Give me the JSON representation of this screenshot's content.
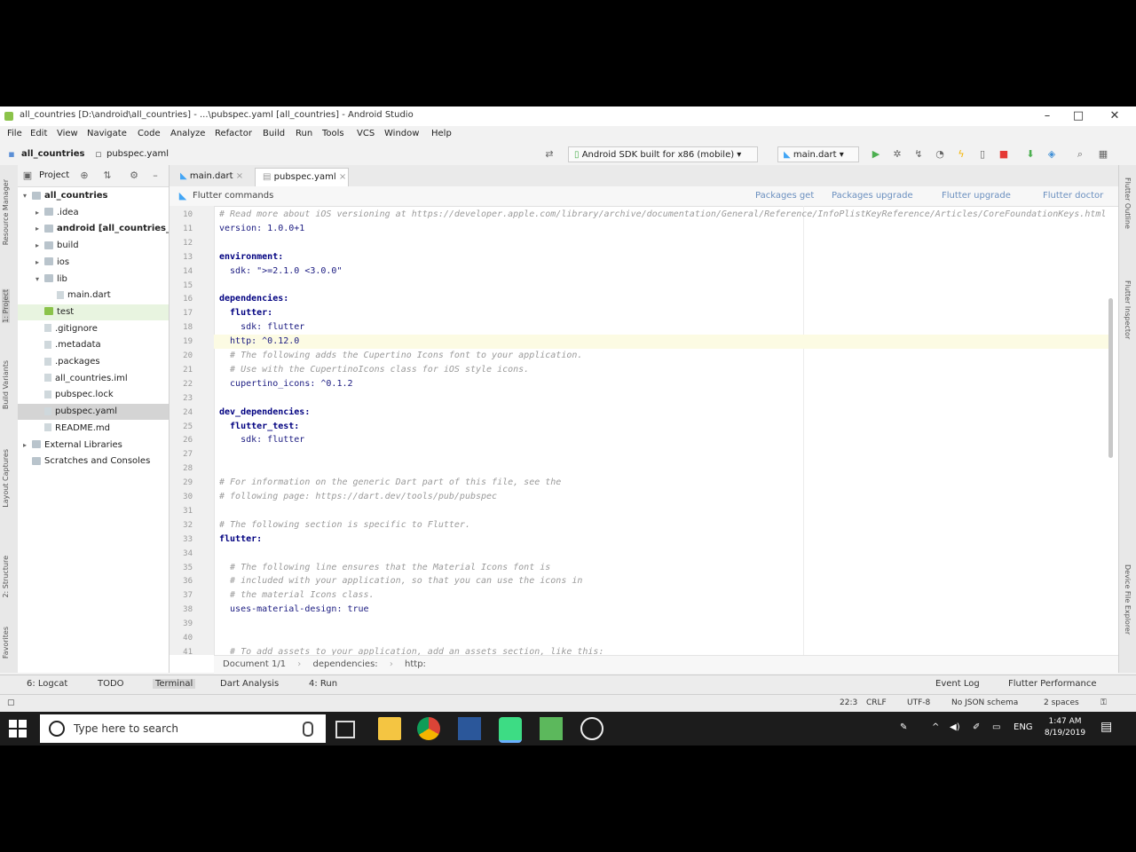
{
  "window": {
    "title": "all_countries [D:\\android\\all_countries] - ...\\pubspec.yaml [all_countries] - Android Studio",
    "controls": [
      "–",
      "□",
      "✕"
    ]
  },
  "menu": [
    "File",
    "Edit",
    "View",
    "Navigate",
    "Code",
    "Analyze",
    "Refactor",
    "Build",
    "Run",
    "Tools",
    "VCS",
    "Window",
    "Help"
  ],
  "navbar": {
    "project_crumb": "all_countries",
    "file_crumb": "pubspec.yaml",
    "device_combo": "Android SDK built for x86 (mobile)",
    "run_config": "main.dart"
  },
  "project_panel": {
    "title": "Project",
    "root_hint": "D:\\android\\all_countries",
    "items": [
      {
        "label": "all_countries",
        "indent": 0,
        "type": "folder",
        "arrow": "▾"
      },
      {
        "label": ".idea",
        "indent": 1,
        "type": "folder",
        "arrow": "▸"
      },
      {
        "label": "android [all_countries_android]",
        "indent": 1,
        "type": "folder",
        "arrow": "▸"
      },
      {
        "label": "build",
        "indent": 1,
        "type": "folder",
        "arrow": "▸"
      },
      {
        "label": "ios",
        "indent": 1,
        "type": "folder",
        "arrow": "▸"
      },
      {
        "label": "lib",
        "indent": 1,
        "type": "folder",
        "arrow": "▾"
      },
      {
        "label": "main.dart",
        "indent": 2,
        "type": "file",
        "arrow": ""
      },
      {
        "label": "test",
        "indent": 1,
        "type": "folder",
        "arrow": ""
      },
      {
        "label": ".gitignore",
        "indent": 1,
        "type": "file",
        "arrow": ""
      },
      {
        "label": ".metadata",
        "indent": 1,
        "type": "file",
        "arrow": ""
      },
      {
        "label": ".packages",
        "indent": 1,
        "type": "file",
        "arrow": ""
      },
      {
        "label": "all_countries.iml",
        "indent": 1,
        "type": "file",
        "arrow": ""
      },
      {
        "label": "pubspec.lock",
        "indent": 1,
        "type": "file",
        "arrow": ""
      },
      {
        "label": "pubspec.yaml",
        "indent": 1,
        "type": "file",
        "arrow": ""
      },
      {
        "label": "README.md",
        "indent": 1,
        "type": "file",
        "arrow": ""
      },
      {
        "label": "External Libraries",
        "indent": 0,
        "type": "folder",
        "arrow": "▸"
      },
      {
        "label": "Scratches and Consoles",
        "indent": 0,
        "type": "folder",
        "arrow": ""
      }
    ]
  },
  "left_tools": [
    "Resource Manager",
    "1: Project",
    "Build Variants",
    "Layout Captures",
    "2: Structure",
    "Favorites"
  ],
  "right_tools": [
    "Flutter Outline",
    "Flutter Inspector",
    "Device File Explorer"
  ],
  "editor": {
    "tabs": [
      "main.dart",
      "pubspec.yaml"
    ],
    "command_bar_label": "Flutter commands",
    "commands": [
      "Packages get",
      "Packages upgrade",
      "Flutter upgrade",
      "Flutter doctor"
    ],
    "lines": [
      {
        "n": "10",
        "text": "# Read more about iOS versioning at https://developer.apple.com/library/archive/documentation/General/Reference/InfoPlistKeyReference/Articles/CoreFoundationKeys.html",
        "kind": "comment"
      },
      {
        "n": "11",
        "text": "version: 1.0.0+1",
        "kind": "kv"
      },
      {
        "n": "12",
        "text": "",
        "kind": "plain"
      },
      {
        "n": "13",
        "text": "environment:",
        "kind": "key"
      },
      {
        "n": "14",
        "text": "  sdk: \">=2.1.0 <3.0.0\"",
        "kind": "kv"
      },
      {
        "n": "15",
        "text": "",
        "kind": "plain"
      },
      {
        "n": "16",
        "text": "dependencies:",
        "kind": "key"
      },
      {
        "n": "17",
        "text": "  flutter:",
        "kind": "key"
      },
      {
        "n": "18",
        "text": "    sdk: flutter",
        "kind": "kv"
      },
      {
        "n": "19",
        "text": "  http: ^0.12.0",
        "kind": "kv"
      },
      {
        "n": "20",
        "text": "  # The following adds the Cupertino Icons font to your application.",
        "kind": "comment"
      },
      {
        "n": "21",
        "text": "  # Use with the CupertinoIcons class for iOS style icons.",
        "kind": "comment"
      },
      {
        "n": "22",
        "text": "  cupertino_icons: ^0.1.2",
        "kind": "kv"
      },
      {
        "n": "23",
        "text": "",
        "kind": "plain"
      },
      {
        "n": "24",
        "text": "dev_dependencies:",
        "kind": "key"
      },
      {
        "n": "25",
        "text": "  flutter_test:",
        "kind": "key"
      },
      {
        "n": "26",
        "text": "    sdk: flutter",
        "kind": "kv"
      },
      {
        "n": "27",
        "text": "",
        "kind": "plain"
      },
      {
        "n": "28",
        "text": "",
        "kind": "plain"
      },
      {
        "n": "29",
        "text": "# For information on the generic Dart part of this file, see the",
        "kind": "comment"
      },
      {
        "n": "30",
        "text": "# following page: https://dart.dev/tools/pub/pubspec",
        "kind": "comment"
      },
      {
        "n": "31",
        "text": "",
        "kind": "plain"
      },
      {
        "n": "32",
        "text": "# The following section is specific to Flutter.",
        "kind": "comment"
      },
      {
        "n": "33",
        "text": "flutter:",
        "kind": "key"
      },
      {
        "n": "34",
        "text": "",
        "kind": "plain"
      },
      {
        "n": "35",
        "text": "  # The following line ensures that the Material Icons font is",
        "kind": "comment"
      },
      {
        "n": "36",
        "text": "  # included with your application, so that you can use the icons in",
        "kind": "comment"
      },
      {
        "n": "37",
        "text": "  # the material Icons class.",
        "kind": "comment"
      },
      {
        "n": "38",
        "text": "  uses-material-design: true",
        "kind": "kv"
      },
      {
        "n": "39",
        "text": "",
        "kind": "plain"
      },
      {
        "n": "40",
        "text": "",
        "kind": "plain"
      },
      {
        "n": "41",
        "text": "  # To add assets to your application, add an assets section, like this:",
        "kind": "comment"
      }
    ],
    "highlight_line": "19",
    "breadcrumb": [
      "Document 1/1",
      "dependencies:",
      "http:"
    ]
  },
  "bottom_tabs": [
    "6: Logcat",
    "TODO",
    "Terminal",
    "Dart Analysis",
    "4: Run"
  ],
  "bottom_right_tabs": [
    "Event Log",
    "Flutter Performance"
  ],
  "status": [
    "22:3",
    "CRLF",
    "UTF-8",
    "No JSON schema",
    "2 spaces"
  ],
  "taskbar": {
    "search_placeholder": "Type here to search",
    "tray": [
      "ENG"
    ],
    "time": "1:47 AM",
    "date": "8/19/2019"
  }
}
